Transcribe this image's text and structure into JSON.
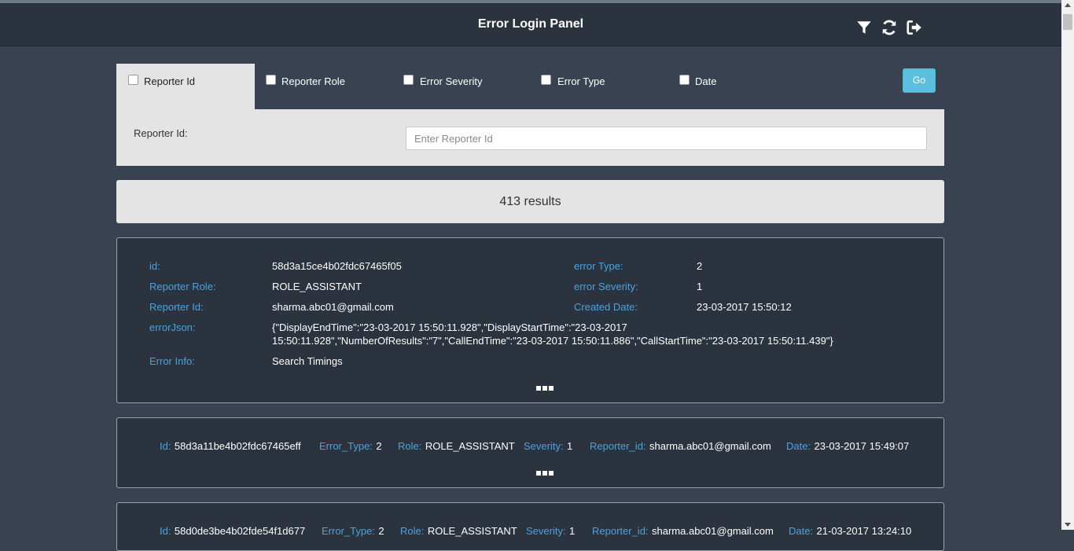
{
  "header": {
    "title": "Error Login Panel"
  },
  "icons": {
    "filter": "filter-icon",
    "refresh": "refresh-icon",
    "logout": "logout-icon"
  },
  "filters": {
    "tabs": [
      {
        "label": "Reporter Id",
        "checked": false,
        "active": true
      },
      {
        "label": "Reporter Role",
        "checked": false,
        "active": false
      },
      {
        "label": "Error Severity",
        "checked": false,
        "active": false
      },
      {
        "label": "Error Type",
        "checked": false,
        "active": false
      },
      {
        "label": "Date",
        "checked": false,
        "active": false
      }
    ],
    "go_label": "Go",
    "panel": {
      "label": "Reporter Id:",
      "placeholder": "Enter Reporter Id",
      "value": ""
    }
  },
  "results": {
    "count_text": "413 results"
  },
  "detail_card": {
    "id_label": "id:",
    "id": "58d3a15ce4b02fdc67465f05",
    "role_label": "Reporter Role:",
    "role": "ROLE_ASSISTANT",
    "reporter_label": "Reporter Id:",
    "reporter": "sharma.abc01@gmail.com",
    "json_label": "errorJson:",
    "json": "{\"DisplayEndTime\":\"23-03-2017 15:50:11.928\",\"DisplayStartTime\":\"23-03-2017 15:50:11.928\",\"NumberOfResults\":\"7\",\"CallEndTime\":\"23-03-2017 15:50:11.886\",\"CallStartTime\":\"23-03-2017 15:50:11.439\"}",
    "info_label": "Error Info:",
    "info": "Search Timings",
    "type_label": "error Type:",
    "type": "2",
    "severity_label": "error Severity:",
    "severity": "1",
    "created_label": "Created Date:",
    "created": "23-03-2017 15:50:12"
  },
  "summary_cards": [
    {
      "id_label": "Id:",
      "id": "58d3a11be4b02fdc67465eff",
      "type_label": "Error_Type:",
      "type": "2",
      "role_label": "Role:",
      "role": "ROLE_ASSISTANT",
      "severity_label": "Severity:",
      "severity": "1",
      "reporter_label": "Reporter_id:",
      "reporter": "sharma.abc01@gmail.com",
      "date_label": "Date:",
      "date": "23-03-2017 15:49:07"
    },
    {
      "id_label": "Id:",
      "id": "58d0de3be4b02fde54f1d677",
      "type_label": "Error_Type:",
      "type": "2",
      "role_label": "Role:",
      "role": "ROLE_ASSISTANT",
      "severity_label": "Severity:",
      "severity": "1",
      "reporter_label": "Reporter_id:",
      "reporter": "sharma.abc01@gmail.com",
      "date_label": "Date:",
      "date": "21-03-2017 13:24:10"
    }
  ]
}
